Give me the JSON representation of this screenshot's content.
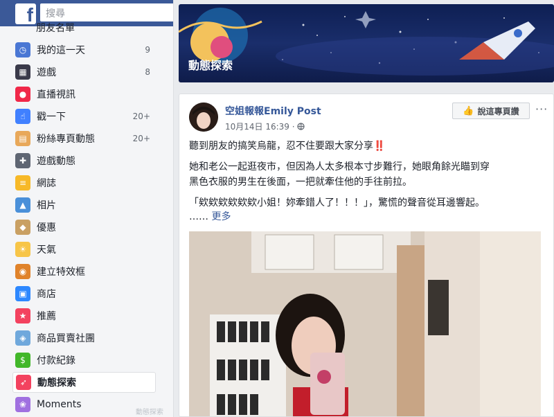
{
  "topbar": {
    "logo_letter": "f",
    "search_placeholder": "搜尋"
  },
  "sidebar": {
    "partial_top_label": "朋友名單",
    "items": [
      {
        "label": "我的這一天",
        "count": "9",
        "icon": "clock-icon",
        "color": "#4a77d4"
      },
      {
        "label": "遊戲",
        "count": "8",
        "icon": "games-icon",
        "color": "#3a3a4a"
      },
      {
        "label": "直播視訊",
        "count": "",
        "icon": "live-video-icon",
        "color": "#f02849"
      },
      {
        "label": "戳一下",
        "count": "20+",
        "icon": "poke-icon",
        "color": "#4080ff"
      },
      {
        "label": "粉絲專頁動態",
        "count": "20+",
        "icon": "pages-feed-icon",
        "color": "#e8a85a"
      },
      {
        "label": "遊戲動態",
        "count": "",
        "icon": "gamepad-icon",
        "color": "#5f6673"
      },
      {
        "label": "網誌",
        "count": "",
        "icon": "notes-icon",
        "color": "#f7b928"
      },
      {
        "label": "相片",
        "count": "",
        "icon": "photos-icon",
        "color": "#4a90d9"
      },
      {
        "label": "優惠",
        "count": "",
        "icon": "offers-icon",
        "color": "#c9a063"
      },
      {
        "label": "天氣",
        "count": "",
        "icon": "weather-icon",
        "color": "#f7c548"
      },
      {
        "label": "建立特效框",
        "count": "",
        "icon": "frames-icon",
        "color": "#e0832b"
      },
      {
        "label": "商店",
        "count": "",
        "icon": "shop-icon",
        "color": "#2d88ff"
      },
      {
        "label": "推薦",
        "count": "",
        "icon": "recommendations-icon",
        "color": "#f3425f"
      },
      {
        "label": "商品買賣社團",
        "count": "",
        "icon": "buy-sell-tag-icon",
        "color": "#6fa8dc"
      },
      {
        "label": "付款紀錄",
        "count": "",
        "icon": "payments-icon",
        "color": "#42b72a"
      },
      {
        "label": "動態探索",
        "count": "",
        "icon": "rocket-icon",
        "color": "#f3425f",
        "active": true
      },
      {
        "label": "Moments",
        "count": "",
        "icon": "moments-icon",
        "color": "#a070e0"
      }
    ],
    "footer_text": "動態探索"
  },
  "banner": {
    "title": "動態探索"
  },
  "post": {
    "page_name": "空姐報報Emily Post",
    "timestamp": "10月14日 16:39",
    "separator": "·",
    "privacy_icon": "globe-icon",
    "like_page_label": "說這專頁讚",
    "more_label": "···",
    "line1": "聽到朋友的搞笑烏龍，忍不住要跟大家分享‼️",
    "line2": "她和老公一起逛夜市，但因為人太多根本寸步難行，她眼角餘光瞄到穿",
    "line3": "黑色衣服的男生在後面，一把就牽住他的手往前拉。",
    "line4": "「欸欸欸欸欸欸小姐！妳牽錯人了！！！」，驚慌的聲音從耳邊響起。",
    "ellipsis": "……",
    "see_more": "更多"
  }
}
